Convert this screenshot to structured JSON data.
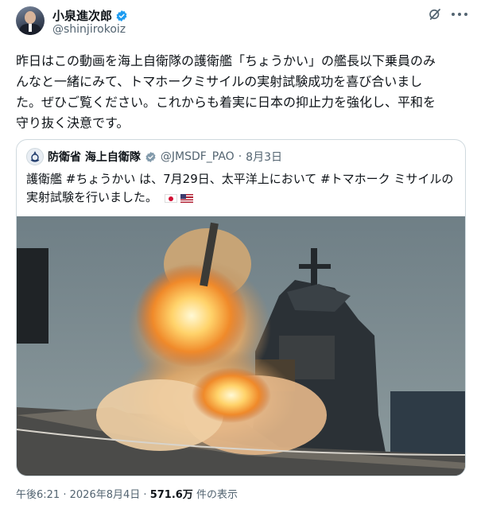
{
  "author": {
    "display_name": "小泉進次郎",
    "handle": "@shinjirokoiz"
  },
  "tweet": {
    "lines": [
      "昨日はこの動画を海上自衛隊の護衛艦「ちょうかい」の艦長以下乗員のみ",
      "んなと一緒にみて、トマホークミサイルの実射試験成功を喜び合いまし",
      "た。ぜひご覧ください。これからも着実に日本の抑止力を強化し、平和を",
      "守り抜く決意です。"
    ]
  },
  "quote": {
    "display_name": "防衛省 海上自衛隊",
    "handle": "@JMSDF_PAO",
    "separator": "·",
    "date": "8月3日",
    "lines": [
      "護衛艦 #ちょうかい は、7月29日、太平洋上において #トマホーク ミサイルの",
      "実射試験を行いました。"
    ],
    "media_label": "missile launch from destroyer deck"
  },
  "footer": {
    "time": "午後6:21",
    "sep1": "·",
    "date": "2026年8月4日",
    "sep2": "·",
    "views_count": "571.6万",
    "views_label": "件の表示"
  },
  "icons": {
    "verified": "verified-badge-icon",
    "grok": "grok-icon",
    "more": "more-icon"
  },
  "colors": {
    "text_primary": "#0f1419",
    "text_secondary": "#536471",
    "verified_blue": "#1d9bf0",
    "border": "#cfd9de"
  }
}
